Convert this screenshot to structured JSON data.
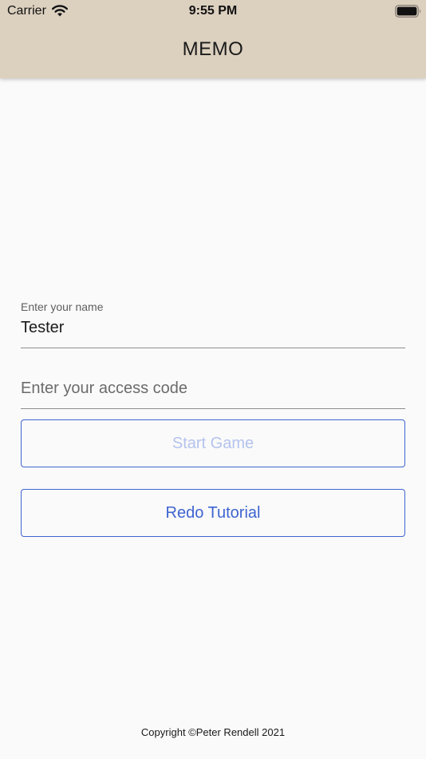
{
  "status_bar": {
    "carrier": "Carrier",
    "time": "9:55 PM",
    "icons": [
      "wifi-icon",
      "battery-icon"
    ]
  },
  "header": {
    "title": "MEMO"
  },
  "form": {
    "name_label": "Enter your name",
    "name_value": "Tester",
    "access_code_placeholder": "Enter your access code",
    "access_code_value": ""
  },
  "buttons": {
    "start_label": "Start Game",
    "redo_label": "Redo Tutorial"
  },
  "footer": {
    "copyright": "Copyright ©Peter Rendell 2021"
  },
  "colors": {
    "header_bg": "#dcd0bf",
    "page_bg": "#fafafa",
    "accent": "#3f64d1",
    "accent_disabled": "#b5c3ee"
  }
}
